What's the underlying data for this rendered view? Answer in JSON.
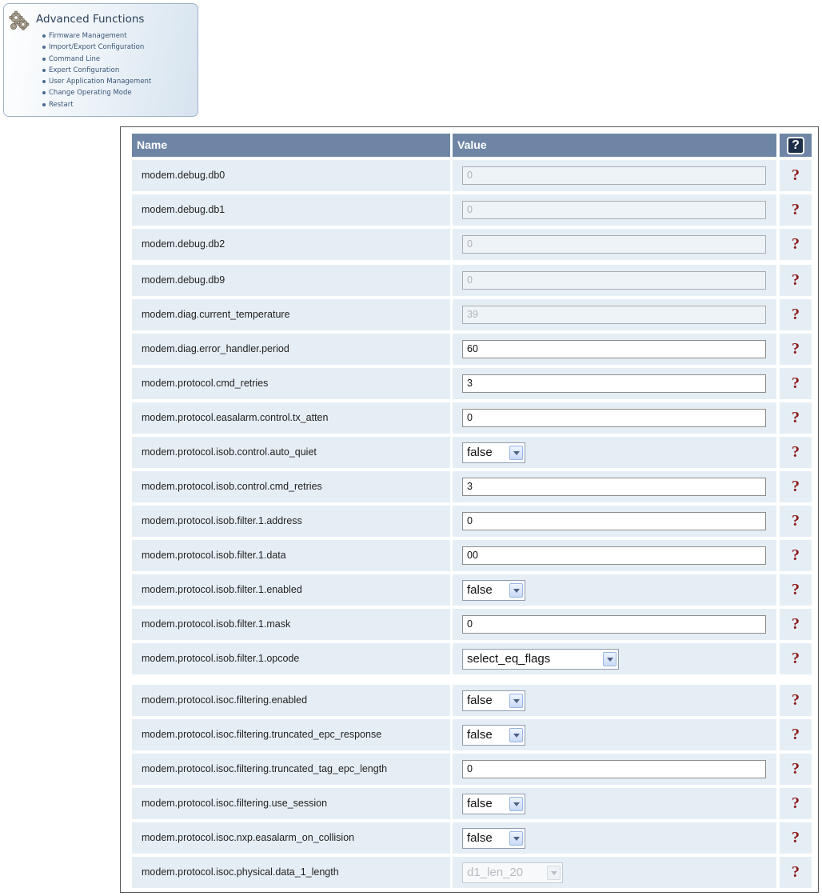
{
  "advanced": {
    "title": "Advanced Functions",
    "links": [
      "Firmware Management",
      "Import/Export Configuration",
      "Command Line",
      "Expert Configuration",
      "User Application Management",
      "Change Operating Mode",
      "Restart"
    ]
  },
  "table": {
    "header": {
      "name": "Name",
      "value": "Value",
      "help": "?"
    },
    "help_glyph": "?",
    "rows": [
      {
        "name": "modem.debug.db0",
        "kind": "text",
        "value": "0",
        "disabled": true
      },
      {
        "name": "modem.debug.db1",
        "kind": "text",
        "value": "0",
        "disabled": true
      },
      {
        "name": "modem.debug.db2",
        "kind": "text",
        "value": "0",
        "disabled": true
      },
      {
        "name": "modem.debug.db9",
        "kind": "text",
        "value": "0",
        "disabled": true
      },
      {
        "name": "modem.diag.current_temperature",
        "kind": "text",
        "value": "39",
        "disabled": true
      },
      {
        "name": "modem.diag.error_handler.period",
        "kind": "text",
        "value": "60",
        "disabled": false
      },
      {
        "name": "modem.protocol.cmd_retries",
        "kind": "text",
        "value": "3",
        "disabled": false
      },
      {
        "name": "modem.protocol.easalarm.control.tx_atten",
        "kind": "text",
        "value": "0",
        "disabled": false
      },
      {
        "name": "modem.protocol.isob.control.auto_quiet",
        "kind": "select",
        "value": "false",
        "disabled": false
      },
      {
        "name": "modem.protocol.isob.control.cmd_retries",
        "kind": "text",
        "value": "3",
        "disabled": false
      },
      {
        "name": "modem.protocol.isob.filter.1.address",
        "kind": "text",
        "value": "0",
        "disabled": false
      },
      {
        "name": "modem.protocol.isob.filter.1.data",
        "kind": "text",
        "value": "00",
        "disabled": false
      },
      {
        "name": "modem.protocol.isob.filter.1.enabled",
        "kind": "select",
        "value": "false",
        "disabled": false
      },
      {
        "name": "modem.protocol.isob.filter.1.mask",
        "kind": "text",
        "value": "0",
        "disabled": false
      },
      {
        "name": "modem.protocol.isob.filter.1.opcode",
        "kind": "select",
        "value": "select_eq_flags",
        "disabled": false
      },
      {
        "name": "modem.protocol.isoc.filtering.enabled",
        "kind": "select",
        "value": "false",
        "disabled": false
      },
      {
        "name": "modem.protocol.isoc.filtering.truncated_epc_response",
        "kind": "select",
        "value": "false",
        "disabled": false
      },
      {
        "name": "modem.protocol.isoc.filtering.truncated_tag_epc_length",
        "kind": "text",
        "value": "0",
        "disabled": false
      },
      {
        "name": "modem.protocol.isoc.filtering.use_session",
        "kind": "select",
        "value": "false",
        "disabled": false
      },
      {
        "name": "modem.protocol.isoc.nxp.easalarm_on_collision",
        "kind": "select",
        "value": "false",
        "disabled": false
      },
      {
        "name": "modem.protocol.isoc.physical.data_1_length",
        "kind": "select",
        "value": "d1_len_20",
        "disabled": true
      }
    ]
  }
}
